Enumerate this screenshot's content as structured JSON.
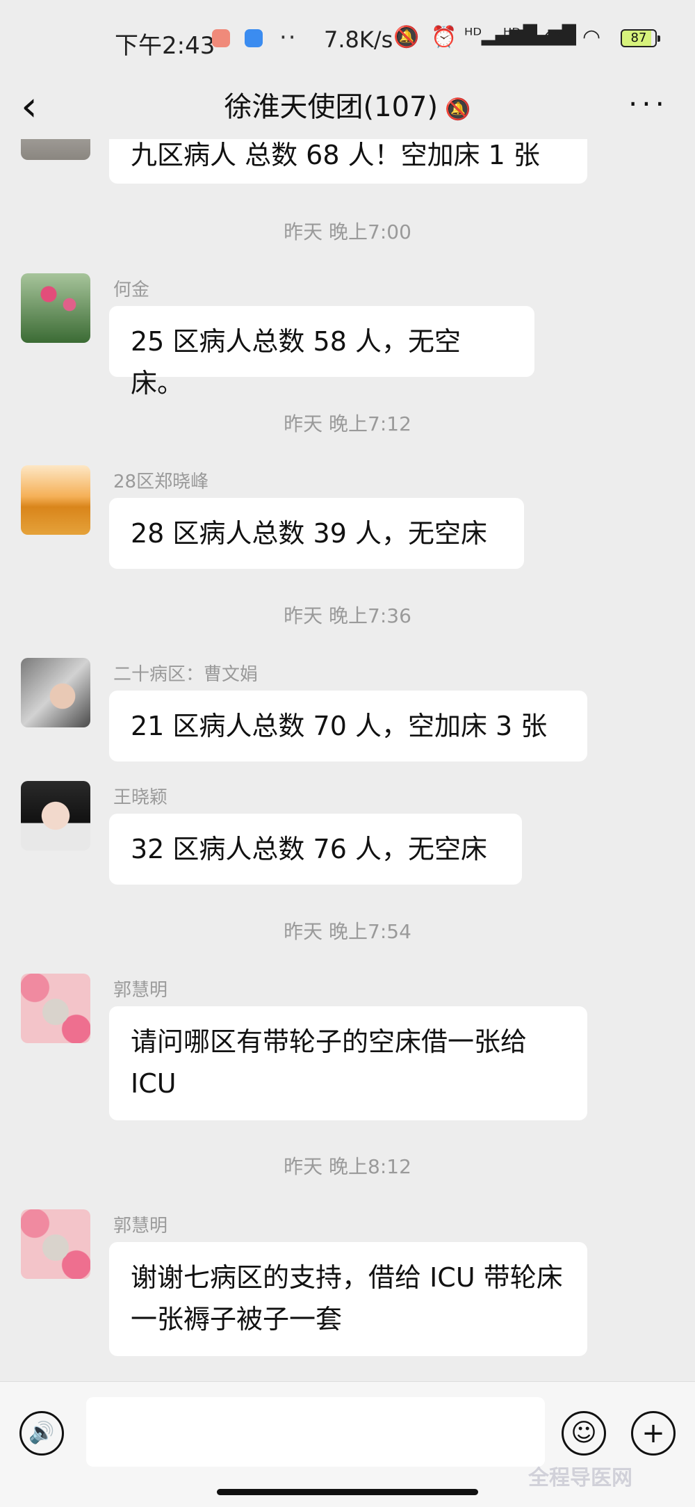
{
  "status": {
    "time": "下午2:43",
    "dots": "··",
    "net_speed": "7.8K/s",
    "battery": "87"
  },
  "header": {
    "back": "‹",
    "title": "徐淮天使团(107)",
    "more": "···"
  },
  "messages": [
    {
      "text": "九区病人 总数 68 人！空加床 1 张"
    },
    {
      "timestamp": "昨天 晚上7:00"
    },
    {
      "sender": "何金",
      "text": "25 区病人总数 58 人，无空床。"
    },
    {
      "timestamp": "昨天 晚上7:12"
    },
    {
      "sender": "28区郑晓峰",
      "text": "28 区病人总数 39 人，无空床"
    },
    {
      "timestamp": "昨天 晚上7:36"
    },
    {
      "sender": "二十病区：曹文娟",
      "text": "21 区病人总数 70 人，空加床 3 张"
    },
    {
      "sender": "王晓颖",
      "text": "32 区病人总数 76 人，无空床"
    },
    {
      "timestamp": "昨天 晚上7:54"
    },
    {
      "sender": "郭慧明",
      "text": "请问哪区有带轮子的空床借一张给ICU"
    },
    {
      "timestamp": "昨天 晚上8:12"
    },
    {
      "sender": "郭慧明",
      "text": "谢谢七病区的支持，借给 ICU 带轮床一张褥子被子一套"
    }
  ],
  "input": {
    "placeholder": ""
  },
  "watermark": "全程导医网"
}
